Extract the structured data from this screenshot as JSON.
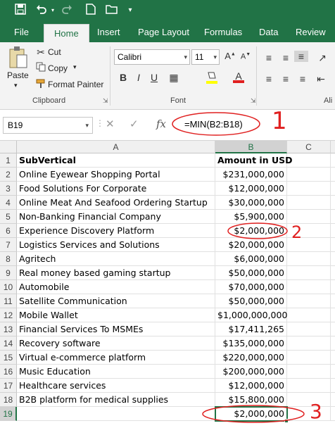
{
  "qat": {
    "save_icon": "save-icon",
    "undo_icon": "undo-icon",
    "redo_icon": "redo-icon",
    "new_icon": "new-file-icon",
    "open_icon": "open-folder-icon",
    "more_icon": "customize-qat-icon"
  },
  "tabs": [
    "File",
    "Home",
    "Insert",
    "Page Layout",
    "Formulas",
    "Data",
    "Review"
  ],
  "ribbon": {
    "clipboard": {
      "paste": "Paste",
      "cut": "Cut",
      "copy": "Copy",
      "format_painter": "Format Painter",
      "label": "Clipboard"
    },
    "font": {
      "name": "Calibri",
      "size": "11",
      "label": "Font"
    },
    "alignment_label_partial": "Ali"
  },
  "formula_bar": {
    "name_box": "B19",
    "fx": "fx",
    "formula": "=MIN(B2:B18)"
  },
  "grid": {
    "columns": [
      "A",
      "B",
      "C"
    ],
    "rows": [
      "1",
      "2",
      "3",
      "4",
      "5",
      "6",
      "7",
      "8",
      "9",
      "10",
      "11",
      "12",
      "13",
      "14",
      "15",
      "16",
      "17",
      "18",
      "19"
    ],
    "data": [
      [
        "SubVertical",
        "Amount in USD"
      ],
      [
        "Online Eyewear Shopping Portal",
        "$231,000,000"
      ],
      [
        "Food Solutions For Corporate",
        "$12,000,000"
      ],
      [
        "Online Meat And Seafood Ordering Startup",
        "$30,000,000"
      ],
      [
        "Non-Banking Financial Company",
        "$5,900,000"
      ],
      [
        "Experience Discovery Platform",
        "$2,000,000"
      ],
      [
        "Logistics Services and Solutions",
        "$20,000,000"
      ],
      [
        "Agritech",
        "$6,000,000"
      ],
      [
        "Real money based gaming startup",
        "$50,000,000"
      ],
      [
        "Automobile",
        "$70,000,000"
      ],
      [
        "Satellite Communication",
        "$50,000,000"
      ],
      [
        "Mobile Wallet",
        "$1,000,000,000"
      ],
      [
        "Financial Services To MSMEs",
        "$17,411,265"
      ],
      [
        "Recovery software",
        "$135,000,000"
      ],
      [
        "Virtual e-commerce platform",
        "$220,000,000"
      ],
      [
        "Music Education",
        "$200,000,000"
      ],
      [
        "Healthcare services",
        "$12,000,000"
      ],
      [
        "B2B platform for medical supplies",
        "$15,800,000"
      ],
      [
        "",
        "$2,000,000"
      ]
    ]
  },
  "annotations": {
    "mark1": "1",
    "mark2": "2",
    "mark3": "3",
    "color": "#e02020"
  },
  "colors": {
    "brand": "#217346",
    "ribbon_bg": "#f3f3f3"
  }
}
